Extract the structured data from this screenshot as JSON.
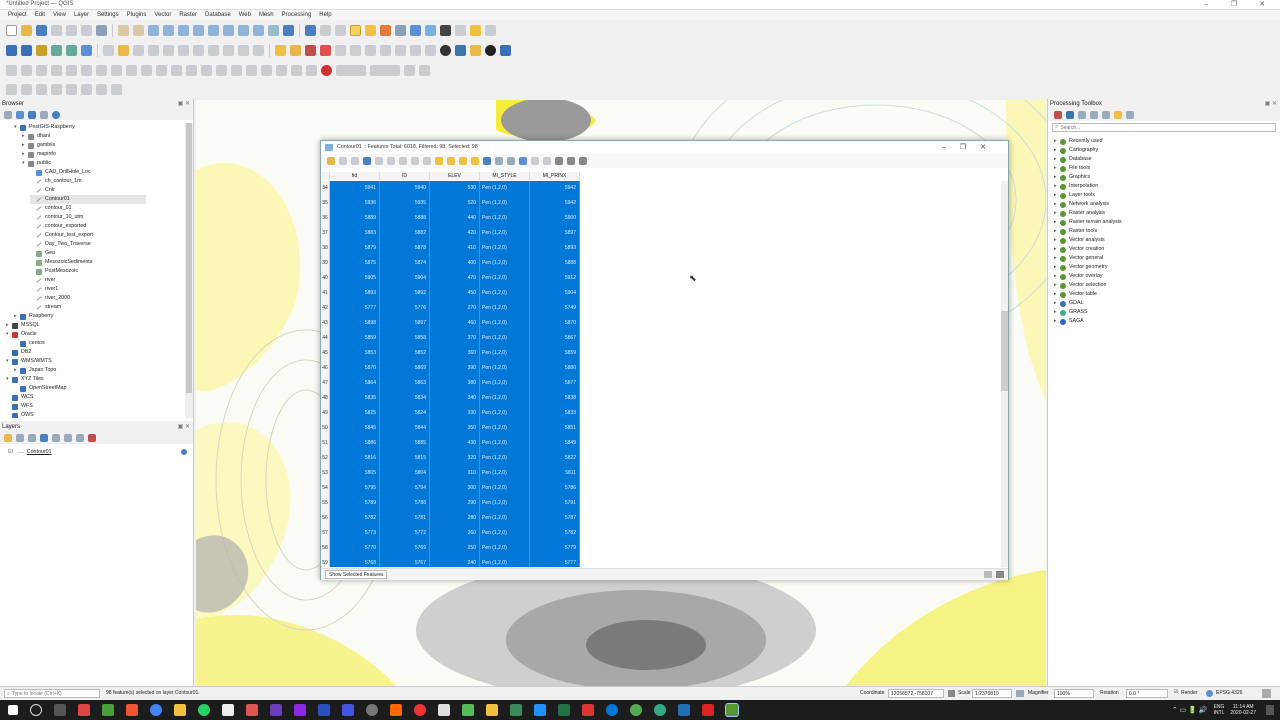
{
  "window": {
    "title": "*Untitled Project — QGIS"
  },
  "menu": [
    "Project",
    "Edit",
    "View",
    "Layer",
    "Settings",
    "Plugins",
    "Vector",
    "Raster",
    "Database",
    "Web",
    "Mesh",
    "Processing",
    "Help"
  ],
  "browser": {
    "title": "Browser",
    "items": [
      {
        "label": "PostGIS-Raspberry",
        "indent": 1,
        "arrow": "▾",
        "icon": "db"
      },
      {
        "label": "dhani",
        "indent": 2,
        "arrow": "▸",
        "icon": "schema"
      },
      {
        "label": "gambiis",
        "indent": 2,
        "arrow": "▸",
        "icon": "schema"
      },
      {
        "label": "mapinfo",
        "indent": 2,
        "arrow": "▸",
        "icon": "schema"
      },
      {
        "label": "public",
        "indent": 2,
        "arrow": "▾",
        "icon": "schema"
      },
      {
        "label": "CAD_DrillHole_Loc",
        "indent": 3,
        "arrow": "",
        "icon": "point"
      },
      {
        "label": "ch_contour_1m",
        "indent": 3,
        "arrow": "",
        "icon": "line"
      },
      {
        "label": "Cntr",
        "indent": 3,
        "arrow": "",
        "icon": "line"
      },
      {
        "label": "Contour01",
        "indent": 3,
        "arrow": "",
        "icon": "line",
        "selected": true
      },
      {
        "label": "contour_01",
        "indent": 3,
        "arrow": "",
        "icon": "line"
      },
      {
        "label": "contour_10_utm",
        "indent": 3,
        "arrow": "",
        "icon": "line"
      },
      {
        "label": "contour_exported",
        "indent": 3,
        "arrow": "",
        "icon": "line"
      },
      {
        "label": "Contour_test_export",
        "indent": 3,
        "arrow": "",
        "icon": "line"
      },
      {
        "label": "Day_Two_Traverse",
        "indent": 3,
        "arrow": "",
        "icon": "line"
      },
      {
        "label": "Geo",
        "indent": 3,
        "arrow": "",
        "icon": "poly"
      },
      {
        "label": "MesozoicSediments",
        "indent": 3,
        "arrow": "",
        "icon": "poly"
      },
      {
        "label": "PostMesozoic",
        "indent": 3,
        "arrow": "",
        "icon": "poly"
      },
      {
        "label": "river",
        "indent": 3,
        "arrow": "",
        "icon": "line"
      },
      {
        "label": "river1",
        "indent": 3,
        "arrow": "",
        "icon": "line"
      },
      {
        "label": "river_2000",
        "indent": 3,
        "arrow": "",
        "icon": "line"
      },
      {
        "label": "stream",
        "indent": 3,
        "arrow": "",
        "icon": "line"
      },
      {
        "label": "Raspberry",
        "indent": 1,
        "arrow": "▸",
        "icon": "db"
      },
      {
        "label": "MSSQL",
        "indent": 0,
        "arrow": "▸",
        "icon": "mssql"
      },
      {
        "label": "Oracle",
        "indent": 0,
        "arrow": "▾",
        "icon": "oracle"
      },
      {
        "label": "centos",
        "indent": 1,
        "arrow": "",
        "icon": "db"
      },
      {
        "label": "DB2",
        "indent": 0,
        "arrow": "",
        "icon": "db2"
      },
      {
        "label": "WMS/WMTS",
        "indent": 0,
        "arrow": "▾",
        "icon": "wms"
      },
      {
        "label": "Japan Topo",
        "indent": 1,
        "arrow": "▸",
        "icon": "wms"
      },
      {
        "label": "XYZ Tiles",
        "indent": 0,
        "arrow": "▾",
        "icon": "xyz"
      },
      {
        "label": "OpenStreetMap",
        "indent": 1,
        "arrow": "",
        "icon": "xyz"
      },
      {
        "label": "WCS",
        "indent": 0,
        "arrow": "",
        "icon": "wms"
      },
      {
        "label": "WFS",
        "indent": 0,
        "arrow": "",
        "icon": "wms"
      },
      {
        "label": "OWS",
        "indent": 0,
        "arrow": "",
        "icon": "wms"
      }
    ]
  },
  "layers": {
    "title": "Layers",
    "items": [
      {
        "label": "Contour01"
      }
    ]
  },
  "toolbox": {
    "title": "Processing Toolbox",
    "search_placeholder": "Search...",
    "items": [
      "Recently used",
      "Cartography",
      "Database",
      "File tools",
      "Graphics",
      "Interpolation",
      "Layer tools",
      "Network analysis",
      "Raster analysis",
      "Raster terrain analysis",
      "Raster tools",
      "Vector analysis",
      "Vector creation",
      "Vector general",
      "Vector geometry",
      "Vector overlay",
      "Vector selection",
      "Vector table",
      "GDAL",
      "GRASS",
      "SAGA"
    ]
  },
  "attr": {
    "title": "Contour01 :: Features Total: 6018, Filtered: 98, Selected: 98",
    "columns": [
      "fid",
      "ID",
      "ELEV",
      "MI_STYLE",
      "MI_PRINX"
    ],
    "rows": [
      [
        "34",
        "5941",
        "5940",
        "530",
        "Pen (1,2,0)",
        "5942"
      ],
      [
        "35",
        "5936",
        "5935",
        "520",
        "Pen (1,2,0)",
        "5942"
      ],
      [
        "36",
        "5889",
        "5888",
        "440",
        "Pen (1,2,0)",
        "5900"
      ],
      [
        "37",
        "5883",
        "5882",
        "420",
        "Pen (1,2,0)",
        "5897"
      ],
      [
        "38",
        "5879",
        "5878",
        "410",
        "Pen (1,2,0)",
        "5893"
      ],
      [
        "39",
        "5875",
        "5874",
        "400",
        "Pen (1,2,0)",
        "5888"
      ],
      [
        "40",
        "5905",
        "5904",
        "470",
        "Pen (1,2,0)",
        "5912"
      ],
      [
        "41",
        "5893",
        "5892",
        "450",
        "Pen (1,2,0)",
        "5904"
      ],
      [
        "42",
        "5777",
        "5776",
        "270",
        "Pen (1,2,0)",
        "5749"
      ],
      [
        "43",
        "5898",
        "5897",
        "460",
        "Pen (1,2,0)",
        "5870"
      ],
      [
        "44",
        "5859",
        "5858",
        "370",
        "Pen (1,2,0)",
        "5867"
      ],
      [
        "45",
        "5853",
        "5852",
        "360",
        "Pen (1,2,0)",
        "5859"
      ],
      [
        "46",
        "5870",
        "5869",
        "390",
        "Pen (1,2,0)",
        "5880"
      ],
      [
        "47",
        "5864",
        "5863",
        "380",
        "Pen (1,2,0)",
        "5877"
      ],
      [
        "48",
        "5835",
        "5834",
        "340",
        "Pen (1,2,0)",
        "5838"
      ],
      [
        "49",
        "5825",
        "5824",
        "330",
        "Pen (1,2,0)",
        "5833"
      ],
      [
        "50",
        "5845",
        "5844",
        "350",
        "Pen (1,2,0)",
        "5851"
      ],
      [
        "51",
        "5886",
        "5885",
        "430",
        "Pen (1,2,0)",
        "5849"
      ],
      [
        "52",
        "5816",
        "5815",
        "320",
        "Pen (1,2,0)",
        "5822"
      ],
      [
        "53",
        "5805",
        "5804",
        "310",
        "Pen (1,2,0)",
        "5811"
      ],
      [
        "54",
        "5795",
        "5794",
        "300",
        "Pen (1,2,0)",
        "5786"
      ],
      [
        "55",
        "5789",
        "5788",
        "290",
        "Pen (1,2,0)",
        "5791"
      ],
      [
        "56",
        "5782",
        "5781",
        "280",
        "Pen (1,2,0)",
        "5787"
      ],
      [
        "57",
        "5773",
        "5772",
        "260",
        "Pen (1,2,0)",
        "5782"
      ],
      [
        "58",
        "5770",
        "5769",
        "250",
        "Pen (1,2,0)",
        "5779"
      ],
      [
        "59",
        "5768",
        "5767",
        "240",
        "Pen (1,2,0)",
        "5777"
      ]
    ],
    "footer_button": "Show Selected Features"
  },
  "status": {
    "locate_placeholder": "Type to locate (Ctrl+K)",
    "message": "98 feature(s) selected on layer Contour01.",
    "coordinate_label": "Coordinate",
    "coordinate": "12056572,-758107",
    "scale_label": "Scale",
    "scale": "1:2376810",
    "magnifier_label": "Magnifier",
    "magnifier": "100%",
    "rotation_label": "Rotation",
    "rotation": "0.0 °",
    "render_label": "Render",
    "crs": "EPSG:4326"
  },
  "clock": {
    "lang": "ENG",
    "locale": "INTL",
    "time": "11:14 AM",
    "date": "2020-02-27"
  },
  "colors": {
    "selection": "#0078d7",
    "map_yellow": "#f4ee3a"
  }
}
